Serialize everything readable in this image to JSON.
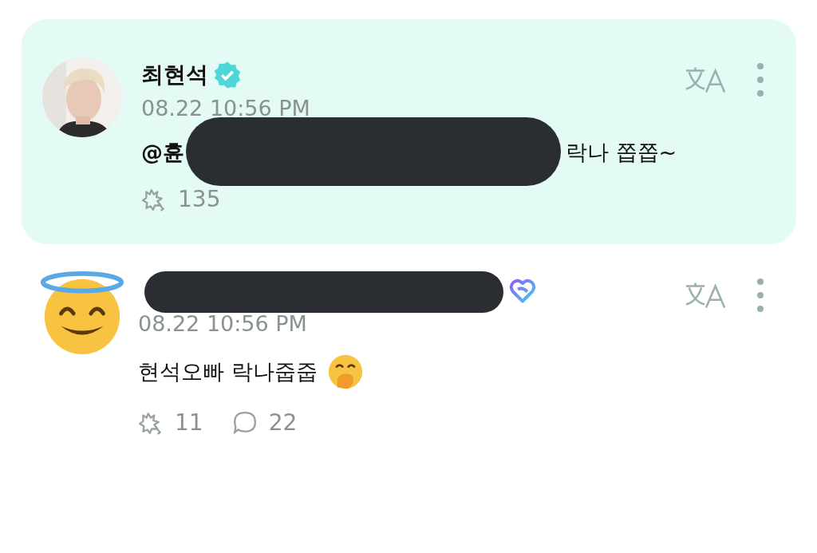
{
  "comments": [
    {
      "highlighted": true,
      "kind": "artist",
      "author": "최현석",
      "name_redacted": false,
      "time": "08.22 10:56 PM",
      "mention": "@휸",
      "text_redacted": true,
      "text": "락나 쫍쫍~",
      "emoji": false,
      "likes": "135"
    },
    {
      "highlighted": false,
      "kind": "fan",
      "name_redacted": true,
      "time": "08.22 10:56 PM",
      "text_redacted": false,
      "text": "현석오빠 락나줍줍",
      "emoji": true,
      "likes": "11",
      "replies": "22"
    }
  ]
}
